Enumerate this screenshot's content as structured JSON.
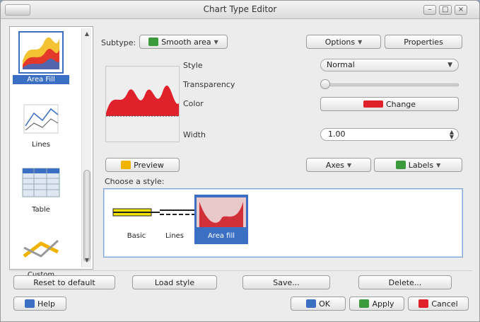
{
  "window": {
    "title": "Chart Type Editor"
  },
  "side_items": [
    {
      "label": "Area Fill",
      "selected": true
    },
    {
      "label": "Lines",
      "selected": false
    },
    {
      "label": "Table",
      "selected": false
    },
    {
      "label": "Custom",
      "selected": false
    }
  ],
  "top": {
    "subtype_label": "Subtype:",
    "subtype_value": "Smooth area",
    "button_one": "Options",
    "button_two": "Properties"
  },
  "props": {
    "style_label": "Style",
    "style_value": "Normal",
    "opacity_label": "Transparency",
    "opacity_level": 0.0,
    "color_label": "Color",
    "color_button": "Change",
    "size_label": "Width",
    "size_value": "1.00"
  },
  "mid": {
    "preview_button": "Preview",
    "left_menu": "Axes",
    "right_menu": "Labels",
    "section_label": "Choose a style:"
  },
  "choices": [
    {
      "label": "Basic",
      "selected": false
    },
    {
      "label": "Lines",
      "selected": false
    },
    {
      "label": "Area fill",
      "selected": true
    }
  ],
  "bottom_row": [
    "Reset to default",
    "Load style",
    "Save...",
    "Delete..."
  ],
  "footer": {
    "help": "Help",
    "ok": "OK",
    "apply": "Apply",
    "cancel": "Cancel"
  },
  "colors": {
    "accent": "#3a6fc4",
    "fill": "#e0202a"
  }
}
